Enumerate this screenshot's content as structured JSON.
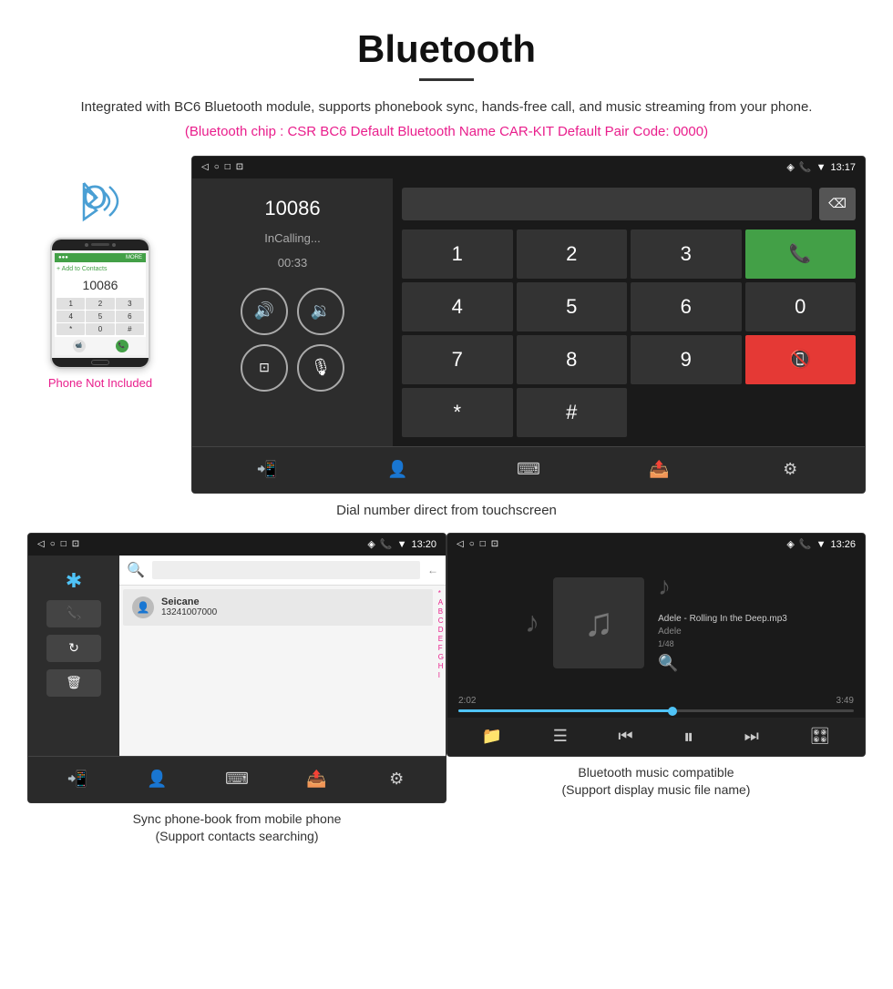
{
  "page": {
    "title": "Bluetooth",
    "subtitle": "Integrated with BC6 Bluetooth module, supports phonebook sync, hands-free call, and music streaming from your phone.",
    "chip_info": "(Bluetooth chip : CSR BC6    Default Bluetooth Name CAR-KIT    Default Pair Code: 0000)",
    "main_caption": "Dial number direct from touchscreen",
    "phonebook_caption_line1": "Sync phone-book from mobile phone",
    "phonebook_caption_line2": "(Support contacts searching)",
    "music_caption_line1": "Bluetooth music compatible",
    "music_caption_line2": "(Support display music file name)",
    "phone_label": "Phone Not Included"
  },
  "status_bar": {
    "time": "13:17",
    "time2": "13:20",
    "time3": "13:26"
  },
  "call_screen": {
    "number": "10086",
    "status": "InCalling...",
    "timer": "00:33"
  },
  "dialpad": {
    "keys": [
      "1",
      "2",
      "3",
      "*",
      "4",
      "5",
      "6",
      "0",
      "7",
      "8",
      "9",
      "#"
    ]
  },
  "contact": {
    "name": "Seicane",
    "number": "13241007000"
  },
  "music": {
    "title": "Adele - Rolling In the Deep.mp3",
    "artist": "Adele",
    "track": "1/48",
    "time_current": "2:02",
    "time_total": "3:49",
    "progress_percent": 55
  },
  "alpha_index": [
    "*",
    "A",
    "B",
    "C",
    "D",
    "E",
    "F",
    "G",
    "H",
    "I"
  ]
}
